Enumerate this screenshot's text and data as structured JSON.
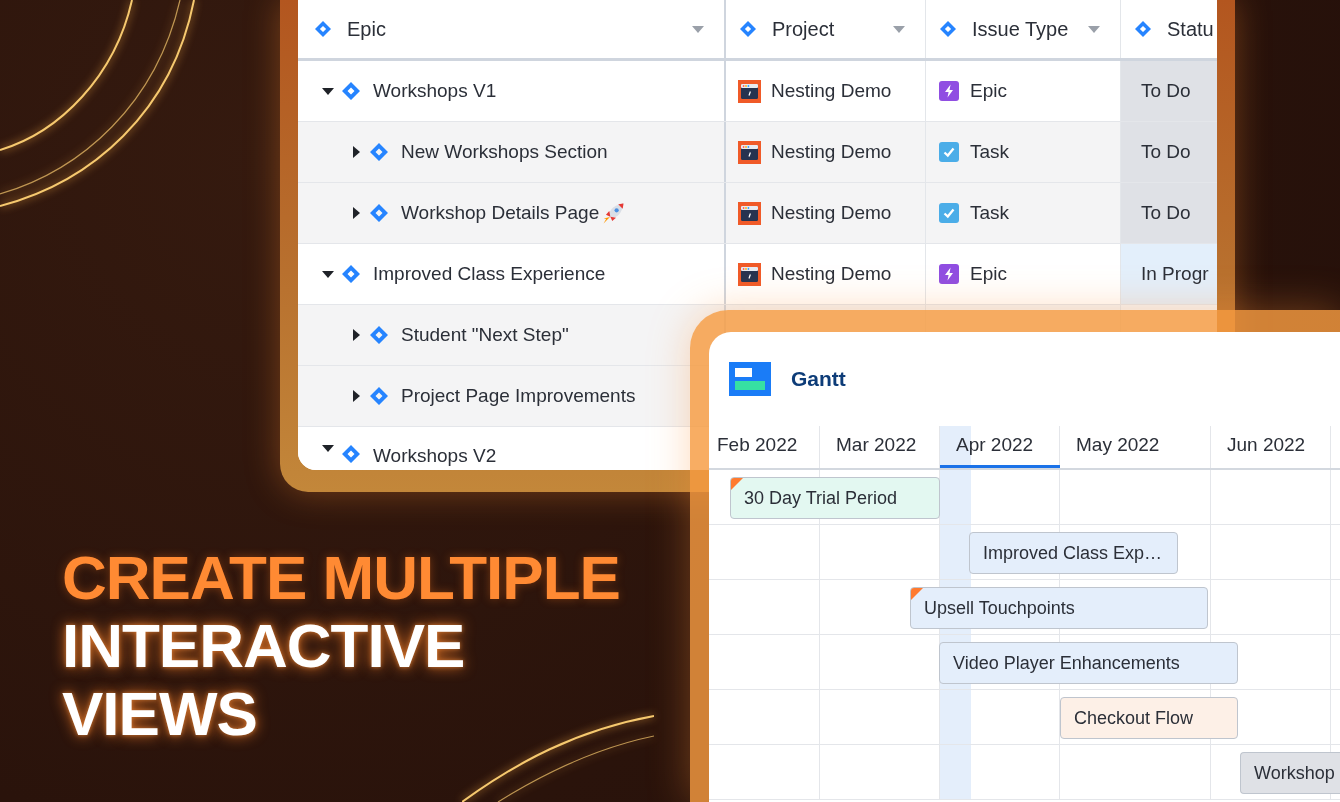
{
  "table": {
    "columns": [
      {
        "label": "Epic",
        "menu": true
      },
      {
        "label": "Project",
        "menu": true
      },
      {
        "label": "Issue Type",
        "menu": true
      },
      {
        "label": "Statu"
      }
    ],
    "rows": [
      {
        "title": "Workshops V1",
        "expanded": true,
        "project": "Nesting Demo",
        "issue_type": {
          "kind": "epic",
          "label": "Epic"
        },
        "status": {
          "label": "To Do",
          "color": "#dfe1e6"
        },
        "children": [
          {
            "title": "New Workshops Section",
            "expanded": false,
            "project": "Nesting Demo",
            "issue_type": {
              "kind": "task",
              "label": "Task"
            },
            "status": {
              "label": "To Do",
              "color": "#dfe1e6"
            }
          },
          {
            "title": "Workshop Details Page",
            "emoji": true,
            "expanded": false,
            "project": "Nesting Demo",
            "issue_type": {
              "kind": "task",
              "label": "Task"
            },
            "status": {
              "label": "To Do",
              "color": "#dfe1e6"
            }
          }
        ]
      },
      {
        "title": "Improved Class Experience",
        "expanded": true,
        "project": "Nesting Demo",
        "issue_type": {
          "kind": "epic",
          "label": "Epic"
        },
        "status": {
          "label": "In Progr",
          "color": "#e3effb"
        },
        "children": [
          {
            "title": "Student \"Next Step\"",
            "expanded": false
          },
          {
            "title": "Project Page Improvements",
            "expanded": false
          }
        ]
      },
      {
        "title": "Workshops V2",
        "expanded": true
      }
    ]
  },
  "gantt": {
    "title": "Gantt",
    "months": [
      {
        "label": "Feb 2022",
        "selected": false
      },
      {
        "label": "Mar 2022",
        "selected": false
      },
      {
        "label": "Apr 2022",
        "selected": true
      },
      {
        "label": "May 2022",
        "selected": false
      },
      {
        "label": "Jun 2022",
        "selected": false
      }
    ],
    "bars": [
      {
        "label": "30 Day Trial Period",
        "color": "#e3f8f1",
        "flagged": true
      },
      {
        "label": "Improved Class Exp…",
        "color": "#e4eefb",
        "flagged": false
      },
      {
        "label": "Upsell Touchpoints",
        "color": "#e4eefb",
        "flagged": true
      },
      {
        "label": "Video Player Enhancements",
        "color": "#e4eefb",
        "flagged": false
      },
      {
        "label": "Checkout Flow",
        "color": "#fdf0e7",
        "flagged": false
      },
      {
        "label": "Workshop",
        "color": "#dfe1e6",
        "flagged": false
      }
    ]
  },
  "headline": [
    {
      "text": "CREATE MULTIPLE",
      "accent": true
    },
    {
      "text": "INTERACTIVE",
      "accent": false
    },
    {
      "text": "VIEWS",
      "accent": false
    }
  ]
}
